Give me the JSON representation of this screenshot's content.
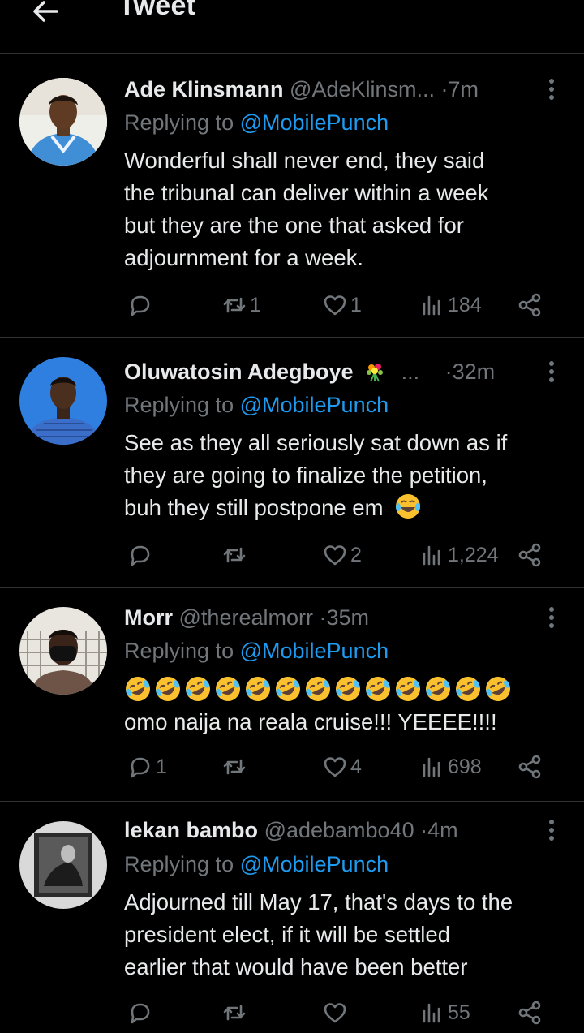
{
  "header": {
    "title": "Tweet",
    "back_icon": "arrow-left-icon"
  },
  "colors": {
    "background": "#000000",
    "text": "#e7e9ea",
    "muted": "#71767b",
    "link": "#1d9bf0",
    "divider": "#2f3336"
  },
  "tweets": [
    {
      "name": "Ade Klinsmann",
      "handle": "@AdeKlinsm...",
      "separator": "·",
      "time": "7m",
      "replying_prefix": "Replying to ",
      "replying_to": "@MobilePunch",
      "lines": [
        "Wonderful shall never end, they said",
        "the tribunal can deliver within a week",
        "but they are the one that asked for",
        "adjournment for a week."
      ],
      "replies": "",
      "retweets": "1",
      "likes": "1",
      "views": "184"
    },
    {
      "name": "Oluwatosin Adegboye",
      "handle": "...",
      "separator": "·",
      "time": "32m",
      "replying_prefix": "Replying to ",
      "replying_to": "@MobilePunch",
      "lines": [
        "See as they all seriously sat down as if",
        "they are going to finalize the petition,",
        "buh they still postpone em"
      ],
      "replies": "",
      "retweets": "",
      "likes": "2",
      "views": "1,224"
    },
    {
      "name": "Morr",
      "handle": "@therealmorr",
      "separator": "·",
      "time": "35m",
      "replying_prefix": "Replying to ",
      "replying_to": "@MobilePunch",
      "emoji_count": 13,
      "lines": [
        "omo naija na reala cruise!!! YEEEE!!!!"
      ],
      "replies": "1",
      "retweets": "",
      "likes": "4",
      "views": "698"
    },
    {
      "name": "lekan bambo",
      "handle": "@adebambo40",
      "separator": "·",
      "time": "4m",
      "replying_prefix": "Replying to ",
      "replying_to": "@MobilePunch",
      "lines": [
        "Adjourned till May 17, that's days to the",
        "president elect, if it will be settled",
        "earlier that would have been better"
      ],
      "replies": "",
      "retweets": "",
      "likes": "",
      "views": "55"
    }
  ]
}
